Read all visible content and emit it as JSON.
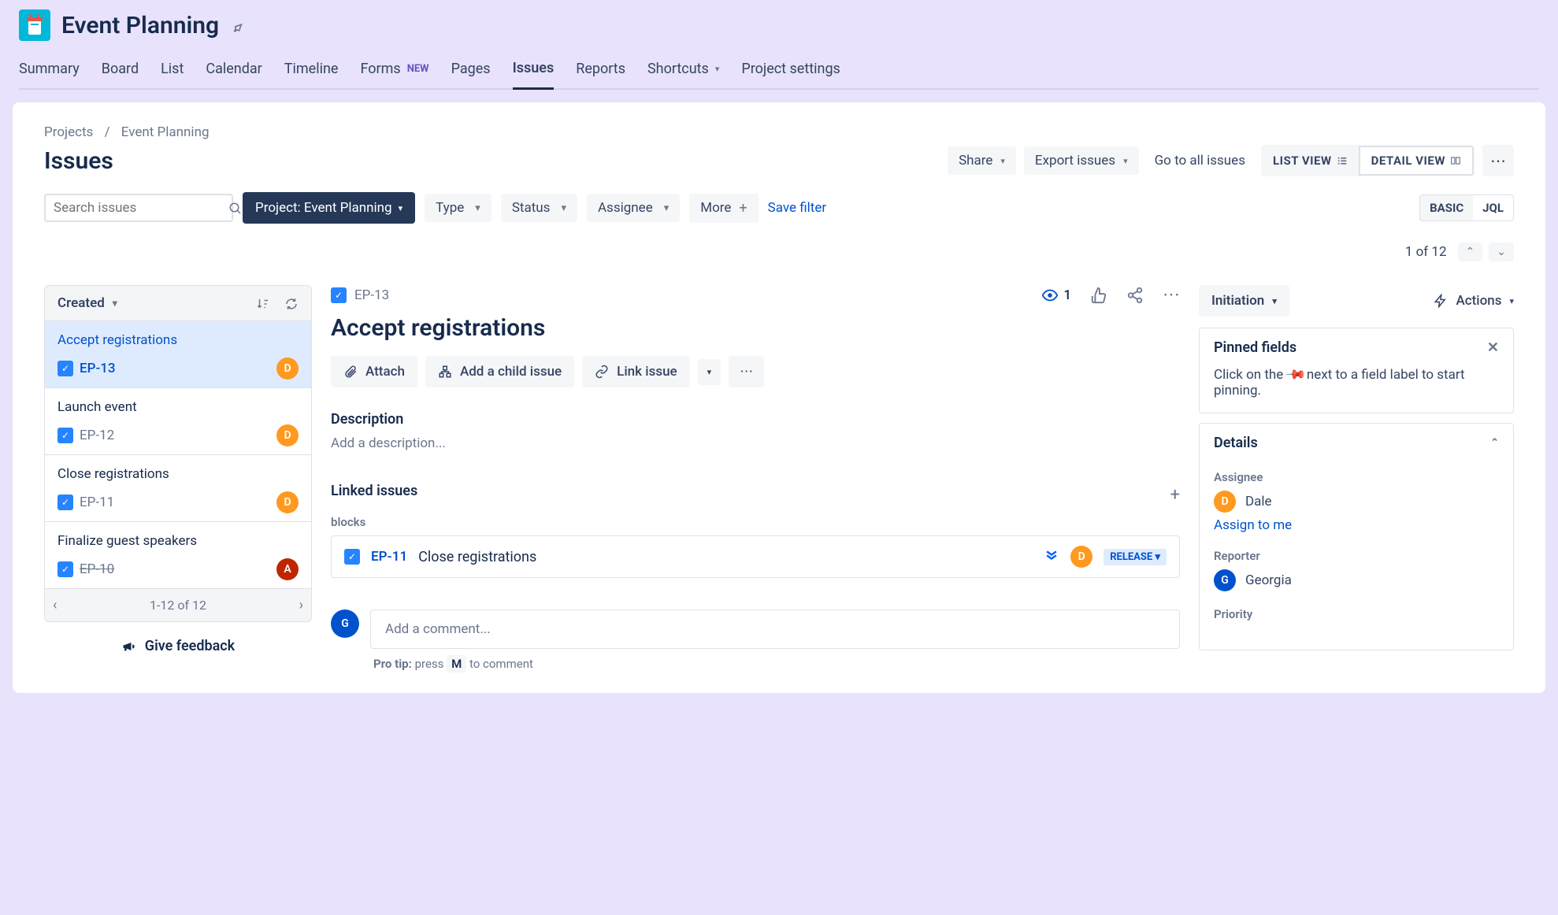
{
  "header": {
    "project_name": "Event Planning",
    "tabs": [
      "Summary",
      "Board",
      "List",
      "Calendar",
      "Timeline",
      "Forms",
      "Pages",
      "Issues",
      "Reports",
      "Shortcuts",
      "Project settings"
    ],
    "new_badge": "NEW",
    "active_tab": "Issues"
  },
  "breadcrumb": {
    "root": "Projects",
    "current": "Event Planning"
  },
  "page": {
    "title": "Issues",
    "share": "Share",
    "export": "Export issues",
    "go_to_all": "Go to all issues",
    "list_view": "LIST VIEW",
    "detail_view": "DETAIL VIEW",
    "pagination": "1 of 12"
  },
  "filters": {
    "search_placeholder": "Search issues",
    "project_filter": "Project: Event Planning",
    "type": "Type",
    "status": "Status",
    "assignee": "Assignee",
    "more": "More",
    "save_filter": "Save filter",
    "basic": "BASIC",
    "jql": "JQL"
  },
  "issue_list": {
    "sort": "Created",
    "footer": "1-12 of 12",
    "feedback": "Give feedback",
    "items": [
      {
        "title": "Accept registrations",
        "key": "EP-13",
        "avatar": "D",
        "avatar_color": "orange",
        "selected": true,
        "done": false
      },
      {
        "title": "Launch event",
        "key": "EP-12",
        "avatar": "D",
        "avatar_color": "orange",
        "selected": false,
        "done": false
      },
      {
        "title": "Close registrations",
        "key": "EP-11",
        "avatar": "D",
        "avatar_color": "orange",
        "selected": false,
        "done": false
      },
      {
        "title": "Finalize guest speakers",
        "key": "EP-10",
        "avatar": "A",
        "avatar_color": "red",
        "selected": false,
        "done": true
      }
    ]
  },
  "detail": {
    "key": "EP-13",
    "title": "Accept registrations",
    "watch_count": "1",
    "attach": "Attach",
    "add_child": "Add a child issue",
    "link_issue": "Link issue",
    "description_header": "Description",
    "description_placeholder": "Add a description...",
    "linked_header": "Linked issues",
    "blocks_label": "blocks",
    "linked": {
      "key": "EP-11",
      "title": "Close registrations",
      "avatar": "D",
      "status": "RELEASE"
    },
    "comment_placeholder": "Add a comment...",
    "pro_tip_label": "Pro tip:",
    "pro_tip_press": "press",
    "pro_tip_key": "M",
    "pro_tip_rest": "to comment"
  },
  "right_panel": {
    "status": "Initiation",
    "actions": "Actions",
    "pinned_header": "Pinned fields",
    "pinned_hint_pre": "Click on the",
    "pinned_hint_post": "next to a field label to start pinning.",
    "details_header": "Details",
    "assignee_label": "Assignee",
    "assignee_name": "Dale",
    "assignee_avatar": "D",
    "assign_to_me": "Assign to me",
    "reporter_label": "Reporter",
    "reporter_name": "Georgia",
    "reporter_avatar": "G",
    "priority_label": "Priority"
  }
}
